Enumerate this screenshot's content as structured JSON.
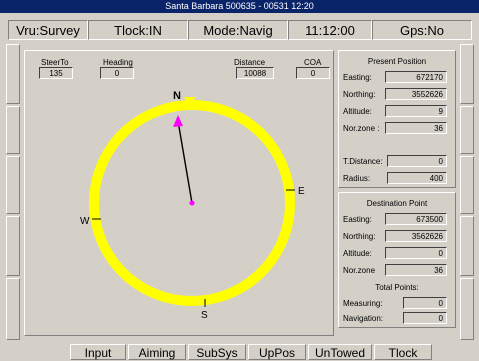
{
  "title": "Santa Barbara 500635 - 00531 12:20",
  "status": {
    "vru": "Vru:Survey",
    "tlock": "Tlock:IN",
    "mode": "Mode:Navig",
    "time": "11:12:00",
    "gps": "Gps:No"
  },
  "nav": {
    "steer_to_label": "SteerTo",
    "steer_to": "135",
    "heading_label": "Heading",
    "heading": "0",
    "distance_label": "Distance",
    "distance": "10088",
    "coa_label": "COA",
    "coa": "0",
    "compass": {
      "n": "N",
      "e": "E",
      "s": "S",
      "w": "W",
      "heading_deg": 352
    }
  },
  "present_position": {
    "title": "Present Position",
    "easting_label": "Easting:",
    "easting": "672170",
    "northing_label": "Northing:",
    "northing": "3552626",
    "altitude_label": "Altitude:",
    "altitude": "9",
    "norzone_label": "Nor.zone :",
    "norzone": "36",
    "tdistance_label": "T.Distance:",
    "tdistance": "0",
    "radius_label": "Radius:",
    "radius": "400"
  },
  "destination": {
    "title": "Destination Point",
    "easting_label": "Easting:",
    "easting": "673500",
    "northing_label": "Northing:",
    "northing": "3562626",
    "altitude_label": "Altitude:",
    "altitude": "0",
    "norzone_label": "Nor.zone",
    "norzone": "36",
    "total_points_label": "Total Points:",
    "measuring_label": "Measuring:",
    "measuring": "0",
    "navigation_label": "Navigation:",
    "navigation": "0"
  },
  "bottom_buttons": [
    "Input",
    "Aiming",
    "SubSys",
    "UpPos",
    "UnTowed",
    "Tlock"
  ],
  "colors": {
    "compass_ring": "#ffff00",
    "pointer": "#ff00ff",
    "title_bg": "#0a246a"
  }
}
